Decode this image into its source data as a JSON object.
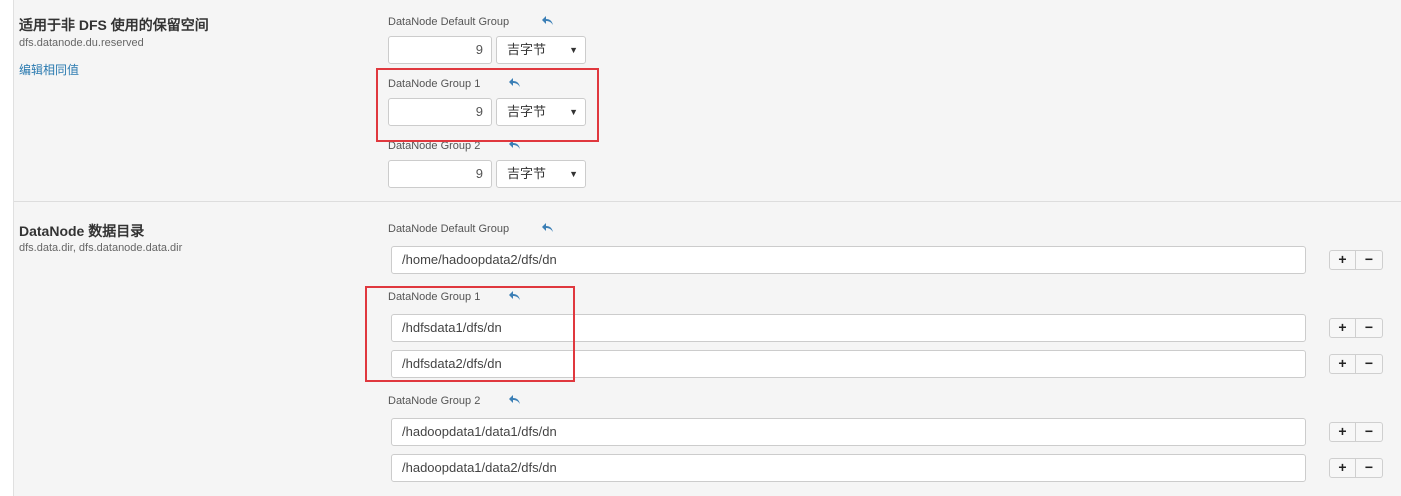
{
  "reserved_space": {
    "title": "适用于非 DFS 使用的保留空间",
    "property": "dfs.datanode.du.reserved",
    "edit_link": "编辑相同值",
    "groups": [
      {
        "label": "DataNode Default Group",
        "value": "9",
        "unit": "吉字节"
      },
      {
        "label": "DataNode Group 1",
        "value": "9",
        "unit": "吉字节"
      },
      {
        "label": "DataNode Group 2",
        "value": "9",
        "unit": "吉字节"
      }
    ]
  },
  "data_dir": {
    "title": "DataNode 数据目录",
    "property": "dfs.data.dir, dfs.datanode.data.dir",
    "groups": [
      {
        "label": "DataNode Default Group",
        "paths": [
          "/home/hadoopdata2/dfs/dn"
        ]
      },
      {
        "label": "DataNode Group 1",
        "paths": [
          "/hdfsdata1/dfs/dn",
          "/hdfsdata2/dfs/dn"
        ]
      },
      {
        "label": "DataNode Group 2",
        "paths": [
          "/hadoopdata1/data1/dfs/dn",
          "/hadoopdata1/data2/dfs/dn"
        ]
      }
    ]
  },
  "buttons": {
    "add": "+",
    "remove": "−"
  },
  "select_caret": "▼",
  "colors": {
    "highlight": "#e0383e",
    "link": "#2a7ab0",
    "undo_icon": "#3b7fb6"
  }
}
